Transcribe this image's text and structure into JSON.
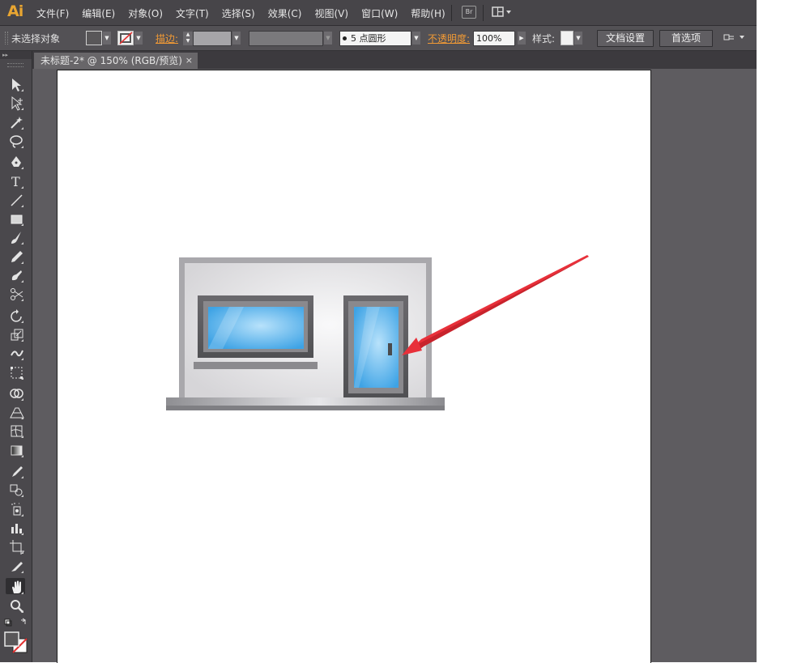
{
  "app": {
    "logo": "Ai"
  },
  "menu": [
    "文件(F)",
    "编辑(E)",
    "对象(O)",
    "文字(T)",
    "选择(S)",
    "效果(C)",
    "视图(V)",
    "窗口(W)",
    "帮助(H)"
  ],
  "menubar_right": {
    "bridge_label": "Br"
  },
  "control_bar": {
    "selection_status": "未选择对象",
    "stroke_label": "描边:",
    "brush_value": "5 点圆形",
    "opacity_label": "不透明度:",
    "opacity_value": "100%",
    "style_label": "样式:",
    "doc_setup_button": "文档设置",
    "prefs_button": "首选项"
  },
  "document_tab": {
    "title": "未标题-2* @ 150% (RGB/预览)",
    "close": "×"
  },
  "tools": [
    "selection-tool",
    "direct-selection-tool",
    "magic-wand-tool",
    "lasso-tool",
    "pen-tool",
    "type-tool",
    "line-segment-tool",
    "rectangle-tool",
    "paintbrush-tool",
    "pencil-tool",
    "blob-brush-tool",
    "scissors-tool",
    "rotate-tool",
    "scale-tool",
    "warp-tool",
    "free-transform-tool",
    "shape-builder-tool",
    "perspective-grid-tool",
    "mesh-tool",
    "gradient-tool",
    "eyedropper-tool",
    "blend-tool",
    "symbol-sprayer-tool",
    "column-graph-tool",
    "artboard-tool",
    "slice-tool",
    "hand-tool",
    "zoom-tool"
  ],
  "colors": {
    "accent_orange": "#f19a35",
    "logo": "#e8a531",
    "glass_blue": "#62b6ea",
    "arrow_red": "#e8303a"
  }
}
